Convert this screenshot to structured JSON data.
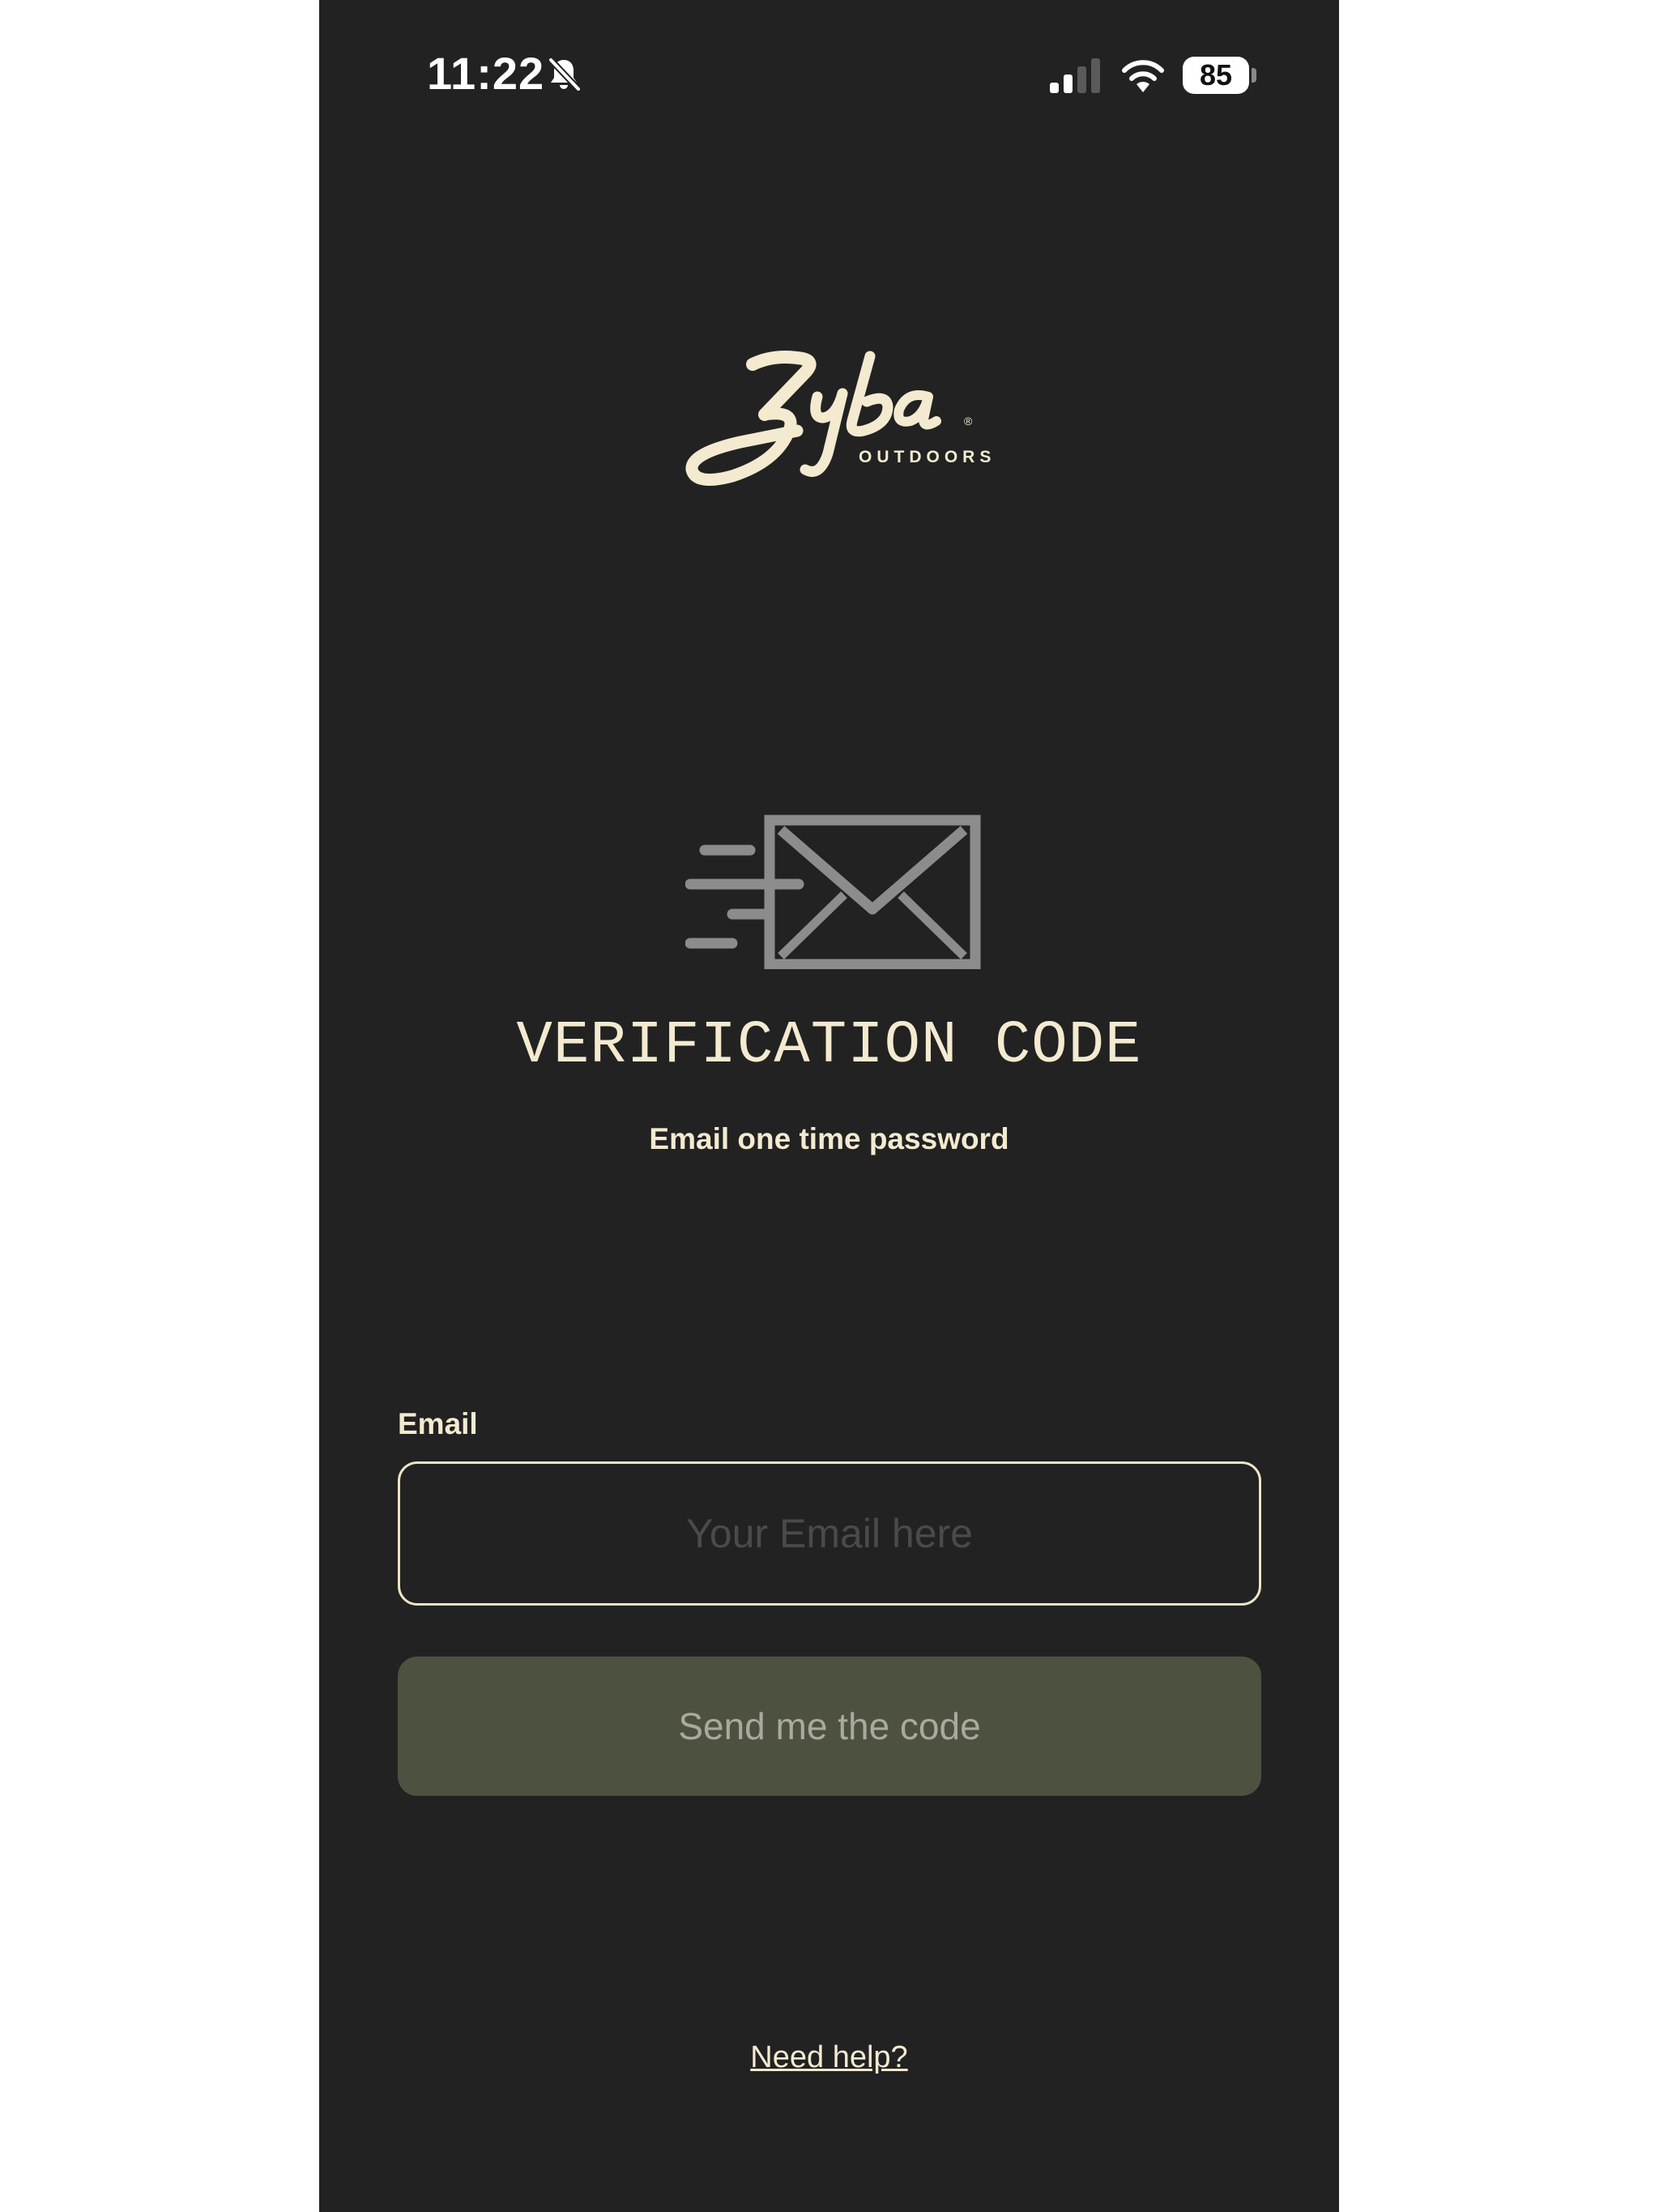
{
  "status_bar": {
    "time": "11:22",
    "battery_level": "85",
    "icons": [
      "bell-slash-icon",
      "cellular-signal-icon",
      "wifi-icon",
      "battery-icon"
    ]
  },
  "logo": {
    "subtitle": "OUTDOORS",
    "registered": "®"
  },
  "verification": {
    "icon": "envelope-sending-icon",
    "title": "VERIFICATION CODE",
    "subtitle": "Email one time password"
  },
  "form": {
    "email_label": "Email",
    "email_placeholder": "Your Email here",
    "email_value": "",
    "send_button_label": "Send me the code"
  },
  "footer": {
    "help_link": "Need help?"
  },
  "colors": {
    "background": "#222222",
    "accent_cream": "#f4ead0",
    "button_disabled": "#4d5240",
    "button_text": "#a9aa9c",
    "placeholder": "#4a4a48"
  }
}
